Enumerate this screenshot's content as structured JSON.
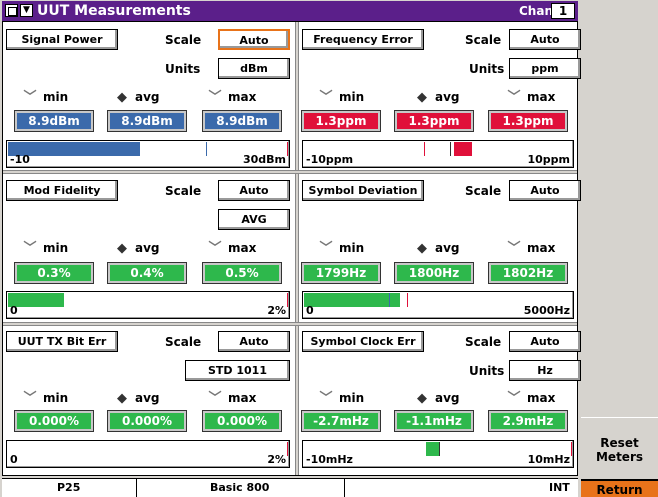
{
  "titlebar": {
    "title": "UUT Measurements",
    "chan_label": "Chan",
    "chan_value": "1",
    "menu_glyph": "▼"
  },
  "radio_labels": {
    "min": "min",
    "avg": "avg",
    "max": "max"
  },
  "panels": {
    "signal_power": {
      "name": "Signal Power",
      "scale_label": "Scale",
      "scale_value": "Auto",
      "units_label": "Units",
      "units_value": "dBm",
      "min": "8.9dBm",
      "avg": "8.9dBm",
      "max": "8.9dBm",
      "range_lo": "-10",
      "range_hi": "30dBm",
      "fill_fraction": 0.47,
      "marker_fraction": 0.71
    },
    "frequency_error": {
      "name": "Frequency Error",
      "scale_label": "Scale",
      "scale_value": "Auto",
      "units_label": "Units",
      "units_value": "ppm",
      "min": "1.3ppm",
      "avg": "1.3ppm",
      "max": "1.3ppm",
      "range_lo": "-10ppm",
      "range_hi": "10ppm",
      "marker_fraction": 0.565
    },
    "mod_fidelity": {
      "name": "Mod Fidelity",
      "scale_label": "Scale",
      "scale_value": "Auto",
      "mode_value": "AVG",
      "min": "0.3%",
      "avg": "0.4%",
      "max": "0.5%",
      "range_lo": "0",
      "range_hi": "2%",
      "fill_fraction": 0.2
    },
    "symbol_deviation": {
      "name": "Symbol Deviation",
      "scale_label": "Scale",
      "scale_value": "Auto",
      "min": "1799Hz",
      "avg": "1800Hz",
      "max": "1802Hz",
      "range_lo": "0",
      "range_hi": "5000Hz",
      "fill_fraction": 0.36
    },
    "uut_tx_bit_err": {
      "name": "UUT TX Bit Err",
      "scale_label": "Scale",
      "scale_value": "Auto",
      "pattern_value": "STD 1011",
      "min": "0.000%",
      "avg": "0.000%",
      "max": "0.000%",
      "range_lo": "0",
      "range_hi": "2%"
    },
    "symbol_clock_err": {
      "name": "Symbol Clock Err",
      "scale_label": "Scale",
      "scale_value": "Auto",
      "units_label": "Units",
      "units_value": "Hz",
      "min": "-2.7mHz",
      "avg": "-1.1mHz",
      "max": "2.9mHz",
      "range_lo": "-10mHz",
      "range_hi": "10mHz"
    }
  },
  "softkeys": {
    "reset_line1": "Reset",
    "reset_line2": "Meters",
    "return": "Return"
  },
  "statusbar": {
    "system": "P25",
    "mode": "Basic 800",
    "reference": "INT"
  },
  "colors": {
    "title_bg": "#5b1f8a",
    "blue": "#3b6aab",
    "red": "#e0103a",
    "green": "#2eb84c",
    "return_bg": "#e8731a"
  }
}
